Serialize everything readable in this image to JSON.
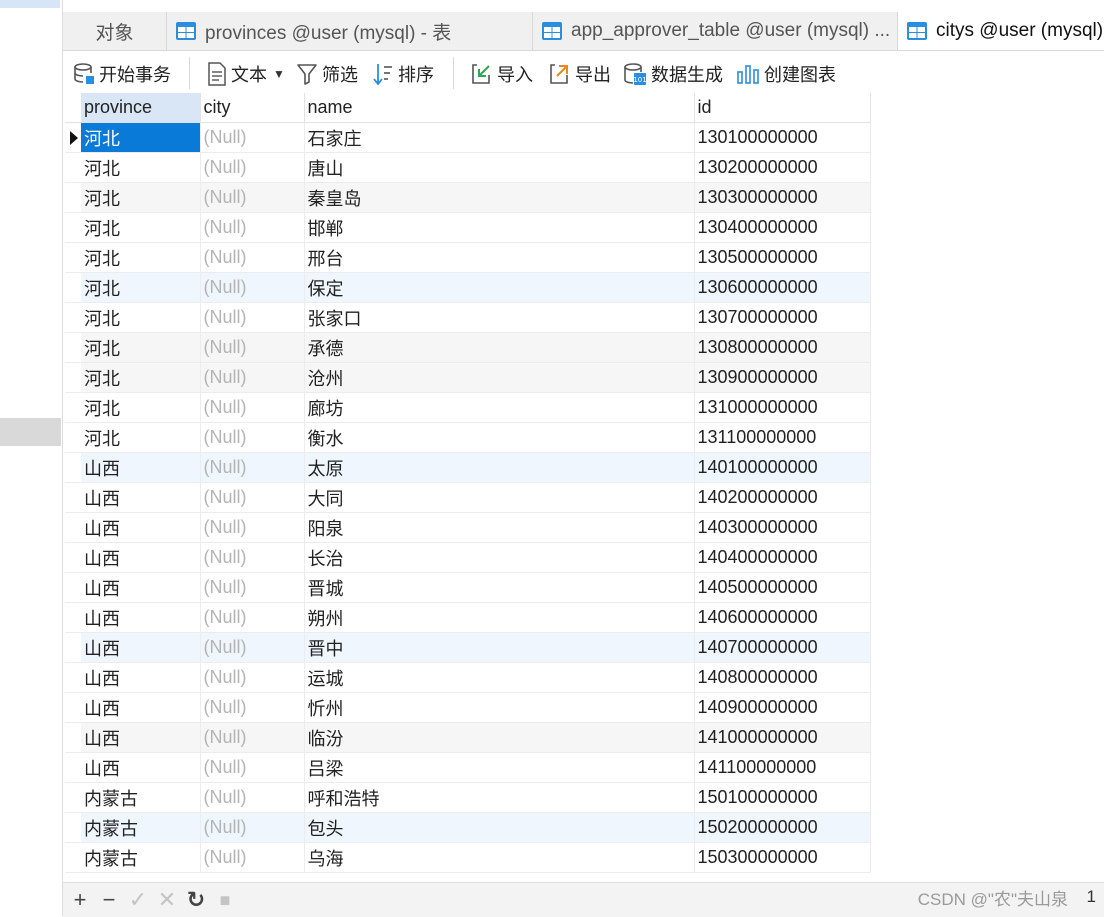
{
  "tabs": [
    {
      "label": "对象"
    },
    {
      "label": "provinces @user (mysql) - 表"
    },
    {
      "label": "app_approver_table @user (mysql) ..."
    },
    {
      "label": "citys @user (mysql)"
    }
  ],
  "toolbar": {
    "begin_transaction": "开始事务",
    "text": "文本",
    "filter": "筛选",
    "sort": "排序",
    "import": "导入",
    "export": "导出",
    "data_generation": "数据生成",
    "create_chart": "创建图表"
  },
  "columns": [
    "province",
    "city",
    "name",
    "id"
  ],
  "rows": [
    {
      "province": "河北",
      "city": "(Null)",
      "name": "石家庄",
      "id": "130100000000"
    },
    {
      "province": "河北",
      "city": "(Null)",
      "name": "唐山",
      "id": "130200000000"
    },
    {
      "province": "河北",
      "city": "(Null)",
      "name": "秦皇岛",
      "id": "130300000000"
    },
    {
      "province": "河北",
      "city": "(Null)",
      "name": "邯郸",
      "id": "130400000000"
    },
    {
      "province": "河北",
      "city": "(Null)",
      "name": "邢台",
      "id": "130500000000"
    },
    {
      "province": "河北",
      "city": "(Null)",
      "name": "保定",
      "id": "130600000000"
    },
    {
      "province": "河北",
      "city": "(Null)",
      "name": "张家口",
      "id": "130700000000"
    },
    {
      "province": "河北",
      "city": "(Null)",
      "name": "承德",
      "id": "130800000000"
    },
    {
      "province": "河北",
      "city": "(Null)",
      "name": "沧州",
      "id": "130900000000"
    },
    {
      "province": "河北",
      "city": "(Null)",
      "name": "廊坊",
      "id": "131000000000"
    },
    {
      "province": "河北",
      "city": "(Null)",
      "name": "衡水",
      "id": "131100000000"
    },
    {
      "province": "山西",
      "city": "(Null)",
      "name": "太原",
      "id": "140100000000"
    },
    {
      "province": "山西",
      "city": "(Null)",
      "name": "大同",
      "id": "140200000000"
    },
    {
      "province": "山西",
      "city": "(Null)",
      "name": "阳泉",
      "id": "140300000000"
    },
    {
      "province": "山西",
      "city": "(Null)",
      "name": "长治",
      "id": "140400000000"
    },
    {
      "province": "山西",
      "city": "(Null)",
      "name": "晋城",
      "id": "140500000000"
    },
    {
      "province": "山西",
      "city": "(Null)",
      "name": "朔州",
      "id": "140600000000"
    },
    {
      "province": "山西",
      "city": "(Null)",
      "name": "晋中",
      "id": "140700000000"
    },
    {
      "province": "山西",
      "city": "(Null)",
      "name": "运城",
      "id": "140800000000"
    },
    {
      "province": "山西",
      "city": "(Null)",
      "name": "忻州",
      "id": "140900000000"
    },
    {
      "province": "山西",
      "city": "(Null)",
      "name": "临汾",
      "id": "141000000000"
    },
    {
      "province": "山西",
      "city": "(Null)",
      "name": "吕梁",
      "id": "141100000000"
    },
    {
      "province": "内蒙古",
      "city": "(Null)",
      "name": "呼和浩特",
      "id": "150100000000"
    },
    {
      "province": "内蒙古",
      "city": "(Null)",
      "name": "包头",
      "id": "150200000000"
    },
    {
      "province": "内蒙古",
      "city": "(Null)",
      "name": "乌海",
      "id": "150300000000"
    }
  ],
  "bottom_bar": {
    "add": "+",
    "delete": "−",
    "apply": "✓",
    "discard": "✕",
    "refresh": "↻",
    "stop": "■",
    "page": "1"
  },
  "watermark": "CSDN @\"农\"夫山泉",
  "colors": {
    "selected_cell": "#0a7ad8",
    "null_text": "#b4b4b4",
    "sorted_header": "#d8e6f6",
    "table_icon": "#2a8ee0"
  }
}
